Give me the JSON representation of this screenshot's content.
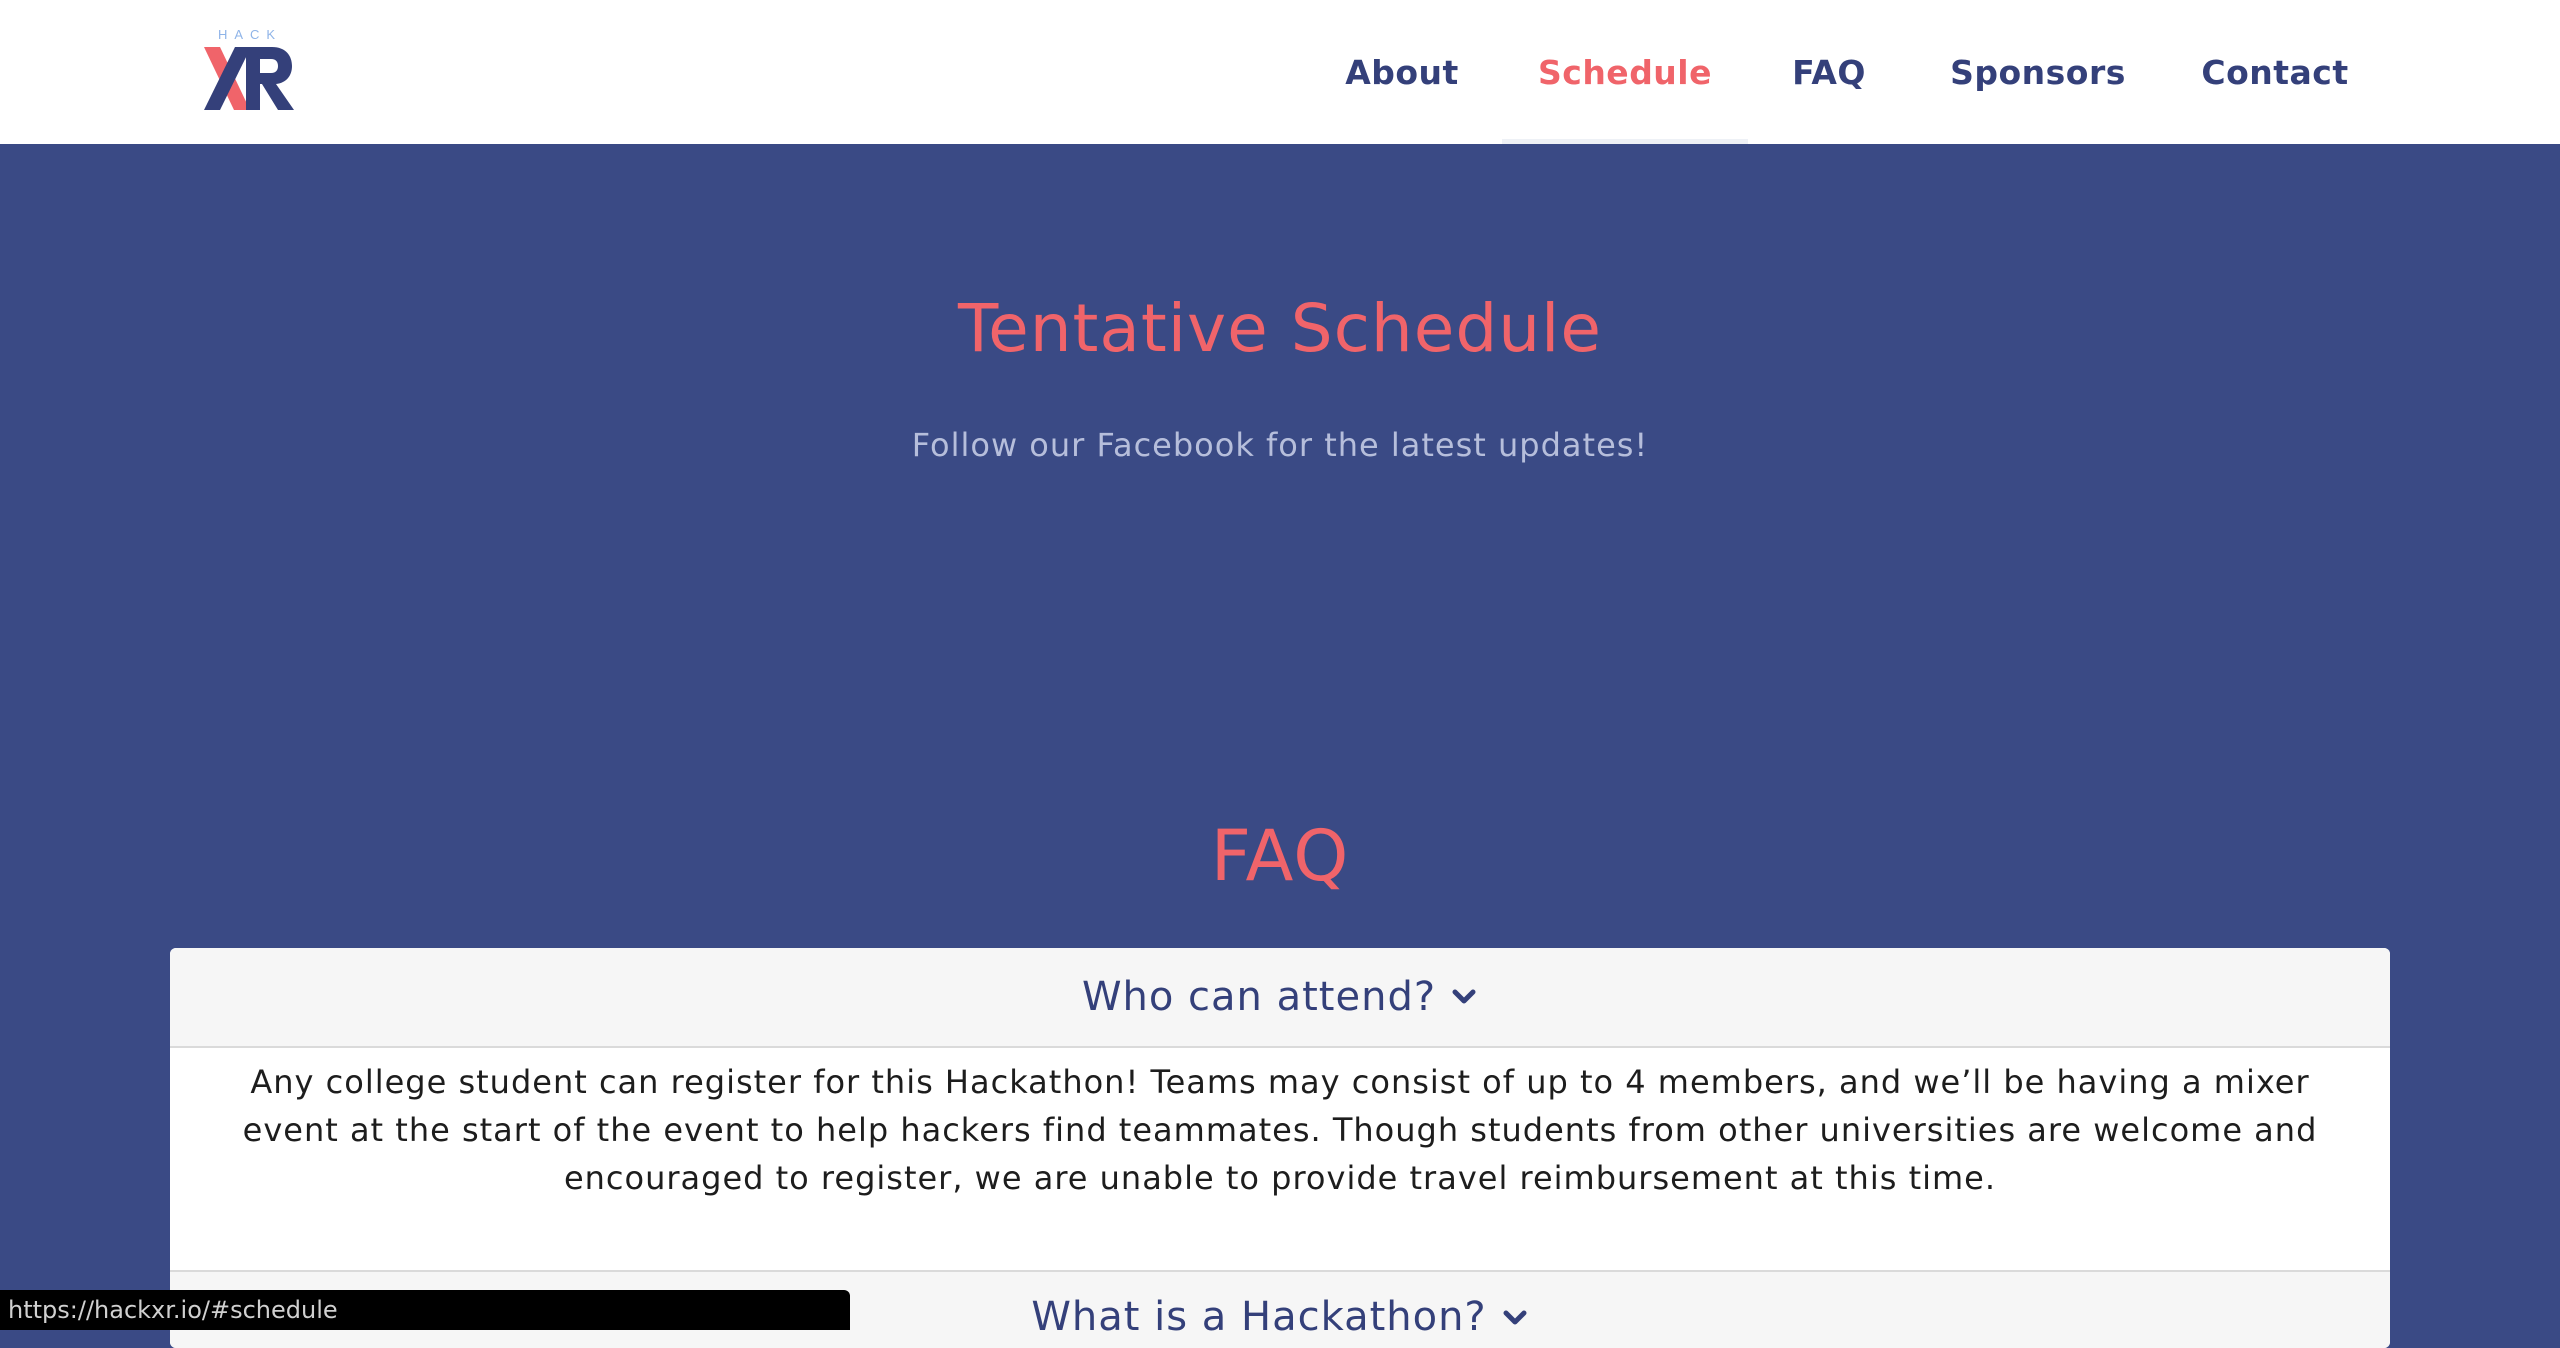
{
  "brand": {
    "logo_small_text": "HACK",
    "logo_main_text": "XR",
    "colors": {
      "navy": "#34407a",
      "coral": "#f0646a",
      "background": "#3a4a85"
    }
  },
  "nav": {
    "items": [
      {
        "label": "About",
        "active": false
      },
      {
        "label": "Schedule",
        "active": true
      },
      {
        "label": "FAQ",
        "active": false
      },
      {
        "label": "Sponsors",
        "active": false
      },
      {
        "label": "Contact",
        "active": false
      }
    ]
  },
  "schedule": {
    "title": "Tentative Schedule",
    "subtitle": "Follow our Facebook for the latest updates!"
  },
  "faq": {
    "title": "FAQ",
    "items": [
      {
        "question": "Who can attend?",
        "answer": "Any college student can register for this Hackathon! Teams may consist of up to 4 members, and we’ll be having a mixer event at the start of the event to help hackers find teammates. Though students from other universities are welcome and encouraged to register, we are unable to provide travel reimbursement at this time.",
        "icon": "chevron-down-icon"
      },
      {
        "question": "What is a Hackathon?",
        "icon": "chevron-down-icon"
      }
    ]
  },
  "status_bar": {
    "url": "https://hackxr.io/#schedule"
  }
}
